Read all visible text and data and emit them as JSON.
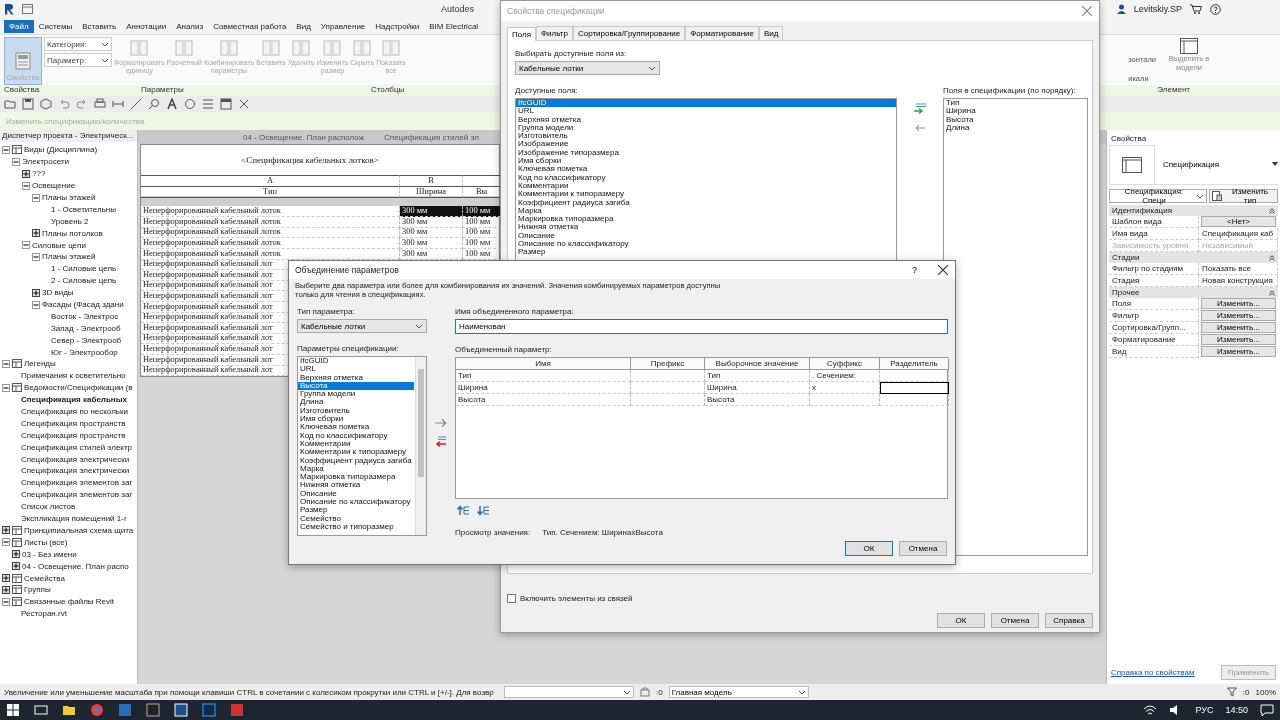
{
  "app": {
    "title": "Autodes",
    "user": "Levitskiy.SP"
  },
  "ribbon_tabs": [
    {
      "label": "Файл",
      "kind": "file"
    },
    {
      "label": "Системы",
      "kind": "tab"
    },
    {
      "label": "Вставить",
      "kind": "tab"
    },
    {
      "label": "Аннотации",
      "kind": "tab"
    },
    {
      "label": "Анализ",
      "kind": "tab"
    },
    {
      "label": "Совместная работа",
      "kind": "tab"
    },
    {
      "label": "Вид",
      "kind": "tab"
    },
    {
      "label": "Управление",
      "kind": "tab"
    },
    {
      "label": "Надстройки",
      "kind": "tab"
    },
    {
      "label": "BIM Electrical",
      "kind": "tab"
    }
  ],
  "ribbon": {
    "properties_button": "Свойства",
    "category_label": "Категория:",
    "parameter_label": "Параметр:",
    "tools": [
      {
        "label": "Форматировать единицу",
        "disabled": true
      },
      {
        "label": "Расчетный",
        "disabled": true
      },
      {
        "label": "Комбинировать параметры",
        "disabled": true
      },
      {
        "label": "Вставить",
        "disabled": true
      },
      {
        "label": "Удалить",
        "disabled": true
      },
      {
        "label": "Изменить размер",
        "disabled": true
      },
      {
        "label": "Скрыть",
        "disabled": true
      },
      {
        "label": "Показать все",
        "disabled": true
      }
    ],
    "right_tools": [
      "зонтали",
      "икали"
    ],
    "select_in_model": "Выделить в модели",
    "panel_labels": [
      "Свойства",
      "Параметры",
      "Столбцы",
      "Элемент"
    ]
  },
  "options_bar": "Изменить спецификацию/количества",
  "project_browser": {
    "title": "Диспетчер проекта - Электрическ...",
    "tree": [
      {
        "label": "Виды (Дисциплина)",
        "expanded": true,
        "children": [
          {
            "label": "Электросети",
            "expanded": true,
            "children": [
              {
                "label": "???",
                "expanded": false
              },
              {
                "label": "Освещение",
                "expanded": true,
                "children": [
                  {
                    "label": "Планы этажей",
                    "expanded": true,
                    "children": [
                      {
                        "label": "1 - Осветительны"
                      },
                      {
                        "label": "Уровень 2"
                      }
                    ]
                  },
                  {
                    "label": "Планы потолков",
                    "expanded": false
                  }
                ]
              },
              {
                "label": "Силовые цепи",
                "expanded": true,
                "children": [
                  {
                    "label": "Планы этажей",
                    "expanded": true,
                    "children": [
                      {
                        "label": "1 - Силовые цепь"
                      },
                      {
                        "label": "2 - Силовые цепь"
                      }
                    ]
                  },
                  {
                    "label": "3D виды",
                    "expanded": false
                  },
                  {
                    "label": "Фасады (Фасад здани",
                    "expanded": true,
                    "children": [
                      {
                        "label": "Восток - Электрос"
                      },
                      {
                        "label": "Запад - Электрооб"
                      },
                      {
                        "label": "Север - Электрооб"
                      },
                      {
                        "label": "Юг - Электрообор"
                      }
                    ]
                  }
                ]
              }
            ]
          }
        ]
      },
      {
        "label": "Легенды",
        "expanded": true,
        "children": [
          {
            "label": "Примечания к осветительно"
          }
        ]
      },
      {
        "label": "Ведомости/Спецификации (в",
        "expanded": true,
        "children": [
          {
            "label": "Спецификация кабельных",
            "active": true
          },
          {
            "label": "Спецификация по нескольки"
          },
          {
            "label": "Спецификация пространств"
          },
          {
            "label": "Спецификация пространств"
          },
          {
            "label": "Спецификация стилей электр"
          },
          {
            "label": "Спецификация электрически"
          },
          {
            "label": "Спецификация электрически"
          },
          {
            "label": "Спецификация элементов заг"
          },
          {
            "label": "Спецификация элементов заг"
          },
          {
            "label": "Список листов"
          },
          {
            "label": "Экспликация помещений 1-г"
          }
        ]
      },
      {
        "label": "Принципиальная схема щита",
        "expanded": false
      },
      {
        "label": "Листы (все)",
        "expanded": true,
        "children": [
          {
            "label": "03 - Без имени",
            "expanded": false
          },
          {
            "label": "04 - Освещение. План распо",
            "expanded": false
          }
        ]
      },
      {
        "label": "Семейства",
        "expanded": false
      },
      {
        "label": "Группы",
        "expanded": false
      },
      {
        "label": "Связанные файлы Revit",
        "expanded": true,
        "children": [
          {
            "label": "Ресторан.rvt"
          }
        ]
      }
    ]
  },
  "view_tabs": [
    "04 - Освещение. План располож",
    "Спецификация стилей эл"
  ],
  "schedule": {
    "title": "<Спецификация кабельных лотков>",
    "column_letters": [
      "A",
      "B"
    ],
    "headers": [
      "Тип",
      "Ширина",
      "Вы"
    ],
    "rows": [
      {
        "cells": [
          "Неперфорированный кабельный лоток",
          "300 мм",
          "100 мм"
        ],
        "selected": true
      },
      {
        "cells": [
          "Неперфорированный кабельный лоток",
          "300 мм",
          "100 мм"
        ],
        "selected": false
      },
      {
        "cells": [
          "Неперфорированный кабельный лоток",
          "300 мм",
          "100 мм"
        ],
        "selected": false
      },
      {
        "cells": [
          "Неперфорированный кабельный лоток",
          "300 мм",
          "100 мм"
        ],
        "selected": false
      },
      {
        "cells": [
          "Неперфорированный кабельный лоток",
          "300 мм",
          "100 мм"
        ],
        "selected": false
      },
      {
        "cells": [
          "Неперфорированный кабельный лот"
        ],
        "selected": false
      },
      {
        "cells": [
          "Неперфорированный кабельный лот"
        ],
        "selected": false
      },
      {
        "cells": [
          "Неперфорированный кабельный лот"
        ],
        "selected": false
      },
      {
        "cells": [
          "Неперфорированный кабельный лот"
        ],
        "selected": false
      },
      {
        "cells": [
          "Неперфорированный кабельный лот"
        ],
        "selected": false
      },
      {
        "cells": [
          "Неперфорированный кабельный лот"
        ],
        "selected": false
      },
      {
        "cells": [
          "Неперфорированный кабельный лот"
        ],
        "selected": false
      },
      {
        "cells": [
          "Неперфорированный кабельный лот"
        ],
        "selected": false
      },
      {
        "cells": [
          "Неперфорированный кабельный лот"
        ],
        "selected": false
      },
      {
        "cells": [
          "Неперфорированный кабельный лот"
        ],
        "selected": false
      },
      {
        "cells": [
          "Неперфорированный кабельный лот"
        ],
        "selected": false
      }
    ]
  },
  "properties": {
    "title": "Свойства",
    "type_name": "Спецификация",
    "instance_selector": "Спецификация: Специ",
    "edit_type": "Изменить тип",
    "groups": [
      {
        "label": "Идентификация",
        "rows": [
          {
            "name": "Шаблон вида",
            "value": "<Нет>",
            "kind": "button"
          },
          {
            "name": "Имя вида",
            "value": "Спецификация каб",
            "kind": "text"
          },
          {
            "name": "Зависимость уровня",
            "value": "Независимый",
            "kind": "text",
            "disabled": true
          }
        ]
      },
      {
        "label": "Стадии",
        "rows": [
          {
            "name": "Фильтр по стадиям",
            "value": "Показать все",
            "kind": "text"
          },
          {
            "name": "Стадия",
            "value": "Новая конструкция",
            "kind": "text"
          }
        ]
      },
      {
        "label": "Прочее",
        "rows": [
          {
            "name": "Поля",
            "value": "Изменить...",
            "kind": "button"
          },
          {
            "name": "Фильтр",
            "value": "Изменить...",
            "kind": "button"
          },
          {
            "name": "Сортировка/Групп...",
            "value": "Изменить...",
            "kind": "button"
          },
          {
            "name": "Форматирование",
            "value": "Изменить...",
            "kind": "button"
          },
          {
            "name": "Вид",
            "value": "Изменить...",
            "kind": "button"
          }
        ]
      }
    ],
    "help_link": "Справка по свойствам",
    "apply": "Применить"
  },
  "schedule_properties_dialog": {
    "title": "Свойства спецификации",
    "tabs": [
      {
        "label": "Поля",
        "selected": true
      },
      {
        "label": "Фильтр",
        "selected": false
      },
      {
        "label": "Сортировка/Группирование",
        "selected": false
      },
      {
        "label": "Форматирование",
        "selected": false
      },
      {
        "label": "Вид",
        "selected": false
      }
    ],
    "source_label": "Выбирать доступные поля из:",
    "source": "Кабельные лотки",
    "available_label": "Доступные поля:",
    "available": [
      {
        "label": "IfcGUID",
        "selected": true
      },
      {
        "label": "URL",
        "selected": false
      },
      {
        "label": "Верхняя отметка",
        "selected": false
      },
      {
        "label": "Группа модели",
        "selected": false
      },
      {
        "label": "Изготовитель",
        "selected": false
      },
      {
        "label": "Изображение",
        "selected": false
      },
      {
        "label": "Изображение типоразмера",
        "selected": false
      },
      {
        "label": "Имя сборки",
        "selected": false
      },
      {
        "label": "Ключевая пометка",
        "selected": false
      },
      {
        "label": "Код по классификатору",
        "selected": false
      },
      {
        "label": "Комментарии",
        "selected": false
      },
      {
        "label": "Комментарии к типоразмеру",
        "selected": false
      },
      {
        "label": "Коэффициент радиуса загиба",
        "selected": false
      },
      {
        "label": "Марка",
        "selected": false
      },
      {
        "label": "Маркировка типоразмера",
        "selected": false
      },
      {
        "label": "Нижняя отметка",
        "selected": false
      },
      {
        "label": "Описание",
        "selected": false
      },
      {
        "label": "Описание по классификатору",
        "selected": false
      },
      {
        "label": "Размер",
        "selected": false
      }
    ],
    "scheduled_label": "Поля в спецификации (по порядку):",
    "scheduled": [
      "Тип",
      "Ширина",
      "Высота",
      "Длина"
    ],
    "include_links": {
      "label": "Включить элементы из связей",
      "checked": false
    },
    "buttons": [
      "ОК",
      "Отмена",
      "Справка"
    ]
  },
  "combine_dialog": {
    "title": "Объединение параметров",
    "help": "?",
    "description": "Выберите два параметра или более для комбинирования их значений.  Значения комбинируемых параметров доступны только для чтения в спецификациях.",
    "type_label": "Тип параметра:",
    "type": "Кабельные лотки",
    "params_label": "Параметры спецификации:",
    "params": [
      {
        "label": "IfcGUID",
        "selected": false
      },
      {
        "label": "URL",
        "selected": false
      },
      {
        "label": "Верхняя отметка",
        "selected": false
      },
      {
        "label": "Высота",
        "selected": true
      },
      {
        "label": "Группа модели",
        "selected": false
      },
      {
        "label": "Длина",
        "selected": false
      },
      {
        "label": "Изготовитель",
        "selected": false
      },
      {
        "label": "Имя сборки",
        "selected": false
      },
      {
        "label": "Ключевая пометка",
        "selected": false
      },
      {
        "label": "Код по классификатору",
        "selected": false
      },
      {
        "label": "Комментарии",
        "selected": false
      },
      {
        "label": "Комментарии к типоразмеру",
        "selected": false
      },
      {
        "label": "Коэффициент радиуса загиба",
        "selected": false
      },
      {
        "label": "Марка",
        "selected": false
      },
      {
        "label": "Маркировка типоразмера",
        "selected": false
      },
      {
        "label": "Нижняя отметка",
        "selected": false
      },
      {
        "label": "Описание",
        "selected": false
      },
      {
        "label": "Описание по классификатору",
        "selected": false
      },
      {
        "label": "Размер",
        "selected": false
      },
      {
        "label": "Семейство",
        "selected": false
      },
      {
        "label": "Семейство и типоразмер",
        "selected": false
      }
    ],
    "name_label": "Имя объединенного параметра:",
    "name_value": "Наименован",
    "combined_label": "Объединенный параметр:",
    "columns": [
      "Имя",
      "Префикс",
      "Выборочное значение",
      "Суффикс",
      "Разделитель"
    ],
    "rows": [
      {
        "name": "Тип",
        "sample": "Тип",
        "suffix": ". Сечением:",
        "selected": false
      },
      {
        "name": "Ширина",
        "sample": "Ширина",
        "suffix": "x",
        "selected": true
      },
      {
        "name": "Высота",
        "sample": "Высота",
        "selected": false
      }
    ],
    "preview_label": "Просмотр значения:",
    "preview": "Тип. Сечением: ШиринахВысота",
    "buttons": [
      "ОК",
      "Отмена"
    ]
  },
  "status_bar": {
    "hint": "Увеличение или уменьшение масштаба при помощи клавиши CTRL в сочетании с колесиком прокрутки или CTRL и [+/-]. Для возвр",
    "selection_count": ":0",
    "model": "Главная модель",
    "filter_count": ":0",
    "zoom": "100%"
  },
  "taskbar": {
    "language": "РУС",
    "time": "14:50"
  }
}
